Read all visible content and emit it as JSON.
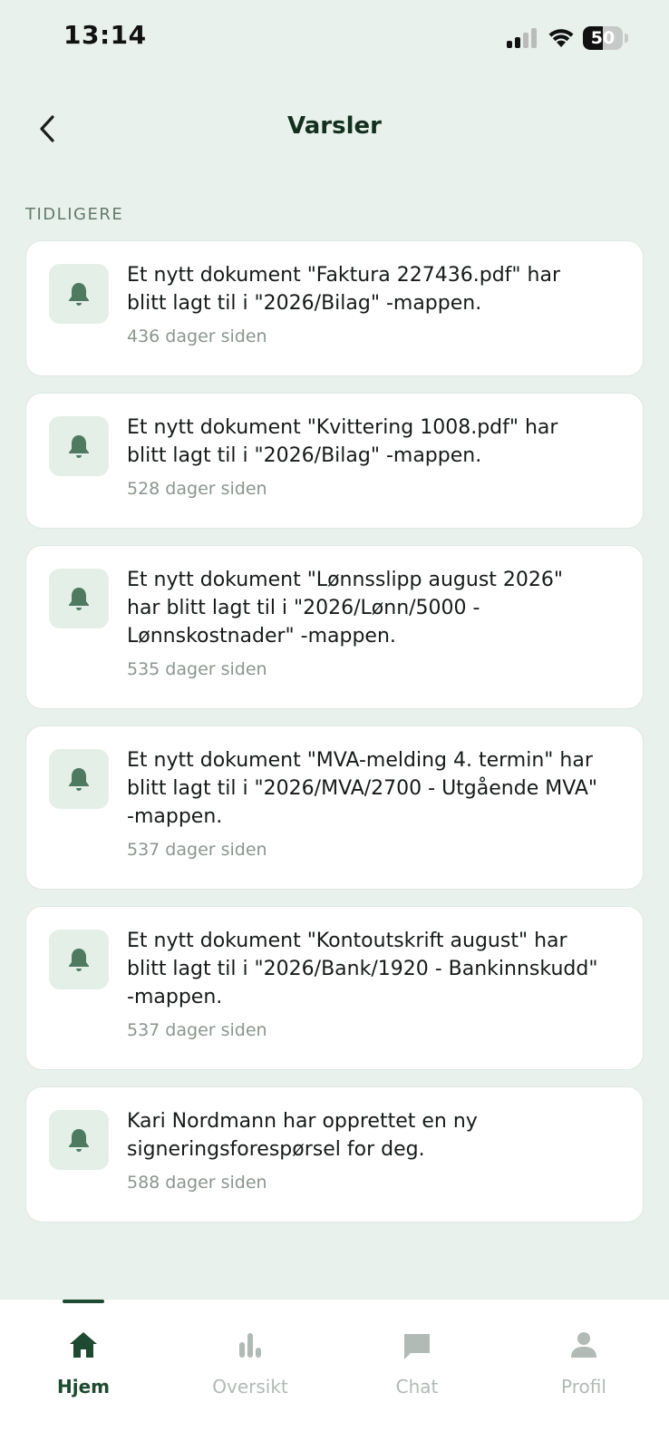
{
  "status_bar": {
    "time": "13:14",
    "battery_level": "50",
    "battery_fraction": 0.5
  },
  "header": {
    "title": "Varsler",
    "back_icon": "chevron-left-icon"
  },
  "section": {
    "label": "TIDLIGERE"
  },
  "notifications": [
    {
      "message": "Et nytt dokument \"Faktura 227436.pdf\" har blitt lagt til i \"2026/Bilag\" -mappen.",
      "time": "436 dager siden",
      "icon": "bell-icon"
    },
    {
      "message": "Et nytt dokument \"Kvittering 1008.pdf\" har blitt lagt til i \"2026/Bilag\" -mappen.",
      "time": "528 dager siden",
      "icon": "bell-icon"
    },
    {
      "message": "Et nytt dokument \"Lønnsslipp august 2026\" har blitt lagt til i \"2026/Lønn/5000 - Lønnskostnader\" -mappen.",
      "time": "535 dager siden",
      "icon": "bell-icon"
    },
    {
      "message": "Et nytt dokument \"MVA-melding 4. termin\" har blitt lagt til i \"2026/MVA/2700 - Utgående MVA\" -mappen.",
      "time": "537 dager siden",
      "icon": "bell-icon"
    },
    {
      "message": "Et nytt dokument \"Kontoutskrift august\" har blitt lagt til i \"2026/Bank/1920 - Bankinnskudd\" -mappen.",
      "time": "537 dager siden",
      "icon": "bell-icon"
    },
    {
      "message": "Kari Nordmann har opprettet en ny signeringsforespørsel for deg.",
      "time": "588 dager siden",
      "icon": "bell-icon"
    }
  ],
  "bottom_nav": {
    "items": [
      {
        "label": "Hjem",
        "icon": "home-icon",
        "active": true
      },
      {
        "label": "Oversikt",
        "icon": "bar-chart-icon",
        "active": false
      },
      {
        "label": "Chat",
        "icon": "chat-icon",
        "active": false
      },
      {
        "label": "Profil",
        "icon": "user-icon",
        "active": false
      }
    ]
  },
  "colors": {
    "background": "#e8f1ec",
    "card": "#ffffff",
    "accent": "#1d4a30",
    "icon_box": "#e4efe8",
    "bell": "#4e7a62",
    "inactive_nav": "#b1bab4"
  }
}
